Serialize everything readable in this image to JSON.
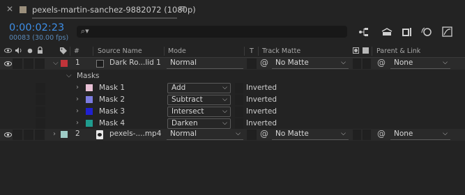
{
  "tab": {
    "close": "✕",
    "title": "pexels-martin-sanchez-9882072 (1080p)",
    "menu": "≡",
    "swatch_color": "#9b8f7c"
  },
  "header": {
    "timecode": "0:00:02:23",
    "frames_fps": "00083 (30.00 fps)",
    "search_placeholder": "",
    "search_icon": "⌕▾"
  },
  "columns": {
    "num": "#",
    "source_name": "Source Name",
    "mode": "Mode",
    "t": "T",
    "track_matte": "Track Matte",
    "parent_link": "Parent & Link"
  },
  "layers": [
    {
      "number": "1",
      "name": "Dark Ro...lid 1",
      "label_color": "#c0343a",
      "mode": "Normal",
      "track_matte": "No Matte",
      "parent": "None",
      "expanded": true
    },
    {
      "number": "2",
      "name": "pexels-....mp4",
      "label_color": "#9fcdc7",
      "mode": "Normal",
      "track_matte": "No Matte",
      "parent": "None",
      "expanded": false
    }
  ],
  "masks_label": "Masks",
  "masks": [
    {
      "name": "Mask 1",
      "color": "#e9c1d6",
      "mode": "Add",
      "inverted": "Inverted"
    },
    {
      "name": "Mask 2",
      "color": "#7c7ce0",
      "mode": "Subtract",
      "inverted": "Inverted"
    },
    {
      "name": "Mask 3",
      "color": "#2020d0",
      "mode": "Intersect",
      "inverted": "Inverted"
    },
    {
      "name": "Mask 4",
      "color": "#1f9c8e",
      "mode": "Darken",
      "inverted": "Inverted"
    }
  ]
}
